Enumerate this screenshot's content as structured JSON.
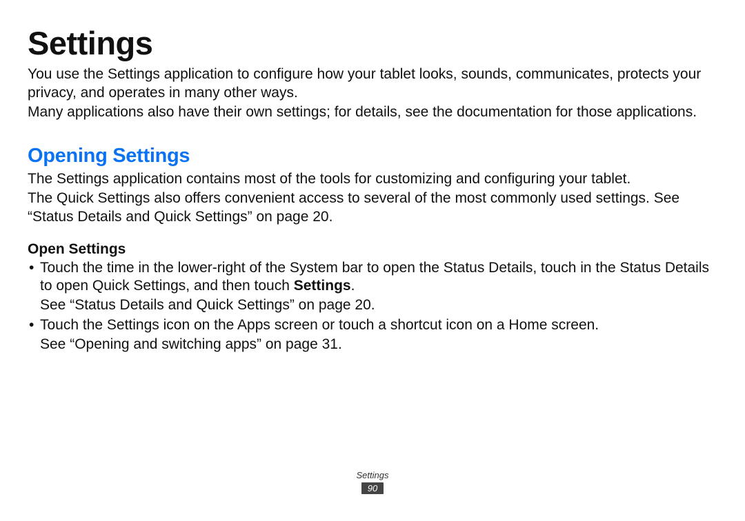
{
  "title": "Settings",
  "intro1": "You use the Settings application to configure how your tablet looks, sounds, communicates, protects your privacy, and operates in many other ways.",
  "intro2": "Many applications also have their own settings; for details, see the documentation for those applications.",
  "section": {
    "heading": "Opening Settings",
    "para1": "The Settings application contains most of the tools for customizing and configuring your tablet.",
    "para2": "The Quick Settings also offers convenient access to several of the most commonly used settings. See “Status Details and Quick Settings” on page 20.",
    "subheading": "Open Settings",
    "bullet1_part1": "Touch the time in the lower-right of the System bar to open the Status Details, touch in the Status Details to open Quick Settings, and then touch ",
    "bullet1_bold": "Settings",
    "bullet1_part2": ".",
    "bullet1_cont": "See “Status Details and Quick Settings” on page 20.",
    "bullet2": "Touch the Settings icon on the Apps screen or touch a shortcut icon on a Home screen.",
    "bullet2_cont": "See “Opening and switching apps” on page 31."
  },
  "footer": {
    "label": "Settings",
    "page": "90"
  }
}
